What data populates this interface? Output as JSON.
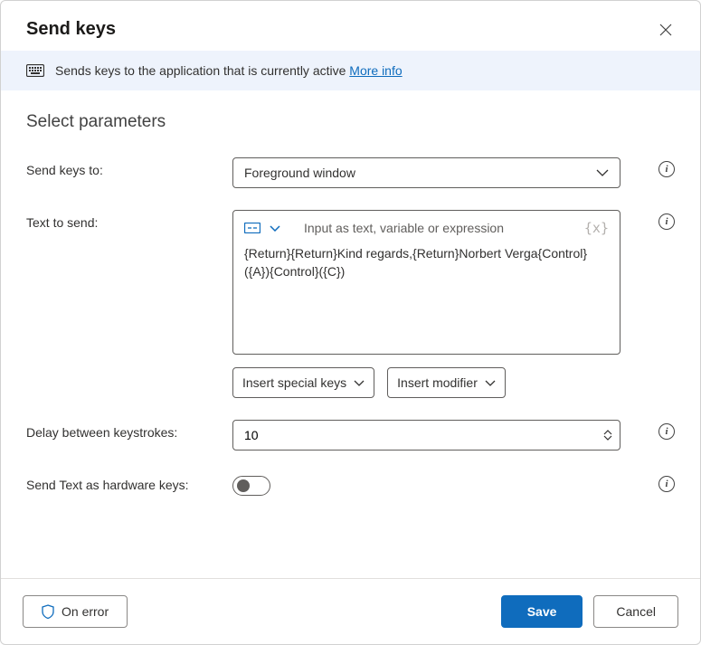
{
  "header": {
    "title": "Send keys"
  },
  "banner": {
    "text": "Sends keys to the application that is currently active ",
    "link": "More info"
  },
  "section_title": "Select parameters",
  "fields": {
    "send_to": {
      "label": "Send keys to:",
      "value": "Foreground window"
    },
    "text_to_send": {
      "label": "Text to send:",
      "placeholder": "Input as text, variable or expression",
      "value": "{Return}{Return}Kind regards,{Return}Norbert Verga{Control}({A}){Control}({C})",
      "insert_special": "Insert special keys",
      "insert_modifier": "Insert modifier"
    },
    "delay": {
      "label": "Delay between keystrokes:",
      "value": "10"
    },
    "hardware": {
      "label": "Send Text as hardware keys:",
      "value": false
    }
  },
  "footer": {
    "on_error": "On error",
    "save": "Save",
    "cancel": "Cancel"
  }
}
